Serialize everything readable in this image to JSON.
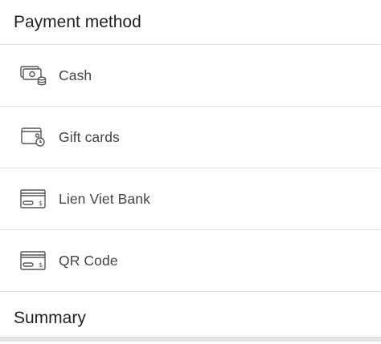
{
  "payment_section": {
    "title": "Payment method"
  },
  "payment_methods": [
    {
      "label": "Cash",
      "icon": "cash-icon"
    },
    {
      "label": "Gift cards",
      "icon": "gift-card-icon"
    },
    {
      "label": "Lien Viet Bank",
      "icon": "bank-card-icon"
    },
    {
      "label": "QR Code",
      "icon": "bank-card-icon"
    }
  ],
  "summary_section": {
    "title": "Summary"
  },
  "colors": {
    "text_primary": "#222222",
    "text_secondary": "#444444",
    "divider": "#e4e4e4",
    "icon_stroke": "#555555"
  }
}
